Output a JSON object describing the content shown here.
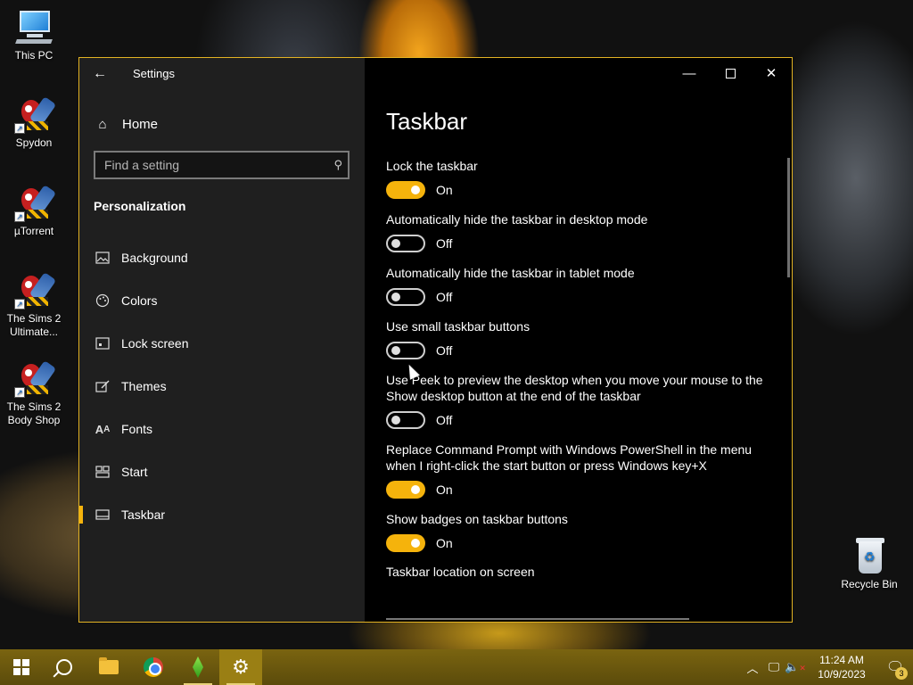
{
  "desktop": {
    "icons": [
      {
        "label": "This PC"
      },
      {
        "label": "Spydon"
      },
      {
        "label": "µTorrent"
      },
      {
        "label": "The Sims 2 Ultimate..."
      },
      {
        "label": "The Sims 2 Body Shop"
      }
    ],
    "recycle_bin": {
      "label": "Recycle Bin"
    }
  },
  "window": {
    "title": "Settings",
    "home_label": "Home",
    "search_placeholder": "Find a setting",
    "section": "Personalization",
    "nav": [
      {
        "label": "Background",
        "icon": "image-icon"
      },
      {
        "label": "Colors",
        "icon": "palette-icon"
      },
      {
        "label": "Lock screen",
        "icon": "lock-screen-icon"
      },
      {
        "label": "Themes",
        "icon": "themes-icon"
      },
      {
        "label": "Fonts",
        "icon": "fonts-icon"
      },
      {
        "label": "Start",
        "icon": "start-icon"
      },
      {
        "label": "Taskbar",
        "icon": "taskbar-icon",
        "active": true
      }
    ],
    "page_title": "Taskbar",
    "settings": [
      {
        "label": "Lock the taskbar",
        "state": "On"
      },
      {
        "label": "Automatically hide the taskbar in desktop mode",
        "state": "Off"
      },
      {
        "label": "Automatically hide the taskbar in tablet mode",
        "state": "Off"
      },
      {
        "label": "Use small taskbar buttons",
        "state": "Off"
      },
      {
        "label": "Use Peek to preview the desktop when you move your mouse to the Show desktop button at the end of the taskbar",
        "state": "Off"
      },
      {
        "label": "Replace Command Prompt with Windows PowerShell in the menu when I right-click the start button or press Windows key+X",
        "state": "On"
      },
      {
        "label": "Show badges on taskbar buttons",
        "state": "On"
      }
    ],
    "location_label": "Taskbar location on screen"
  },
  "taskbar": {
    "time": "11:24 AM",
    "date": "10/9/2023",
    "notification_count": "3"
  },
  "colors": {
    "accent": "#f5b30c",
    "taskbar": "#6b570d"
  }
}
